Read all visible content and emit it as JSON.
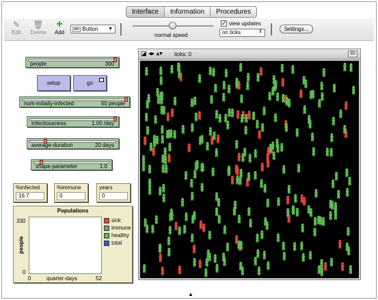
{
  "tabs": [
    {
      "label": "Interface"
    },
    {
      "label": "Information"
    },
    {
      "label": "Procedures"
    }
  ],
  "toolbar": {
    "edit": "Edit",
    "delete": "Delete",
    "add": "Add",
    "widget_type": "Button",
    "speed_label": "normal speed",
    "speed_value": 0.5,
    "view_updates_label": "view updates",
    "view_updates_checked": true,
    "update_mode": "on ticks",
    "settings": "Settings..."
  },
  "sliders": [
    {
      "label": "people",
      "value": "300",
      "fraction": 1.0
    },
    {
      "label": "num-initially-infected",
      "value": "50 people",
      "fraction": 1.0
    },
    {
      "label": "infectiousness",
      "value": "1.00 /day",
      "fraction": 1.0
    },
    {
      "label": "average-duration",
      "value": "20 days",
      "fraction": 0.17
    },
    {
      "label": "shape-parameter",
      "value": "1.0",
      "fraction": 0.08
    }
  ],
  "buttons": {
    "setup": "setup",
    "go": "go"
  },
  "monitors": [
    {
      "label": "%infected",
      "value": "16.7"
    },
    {
      "label": "%immune",
      "value": "0"
    },
    {
      "label": "years",
      "value": "0"
    }
  ],
  "plot": {
    "title": "Populations",
    "ylabel": "people",
    "xlabel": "quarter-days",
    "ymax": "330",
    "ymin": "0",
    "xmin": "0",
    "xmax": "52",
    "legend": [
      {
        "name": "sick",
        "color": "#e0473a"
      },
      {
        "name": "immune",
        "color": "#8c8c8c"
      },
      {
        "name": "healthy",
        "color": "#5fbd54"
      },
      {
        "name": "total",
        "color": "#3e56c9"
      }
    ]
  },
  "view": {
    "ticks_label": "ticks: 0",
    "three_d": "3D",
    "sick_color": "#e0473a",
    "healthy_color": "#5fbd54",
    "healthy_count": 250,
    "sick_count": 50
  }
}
